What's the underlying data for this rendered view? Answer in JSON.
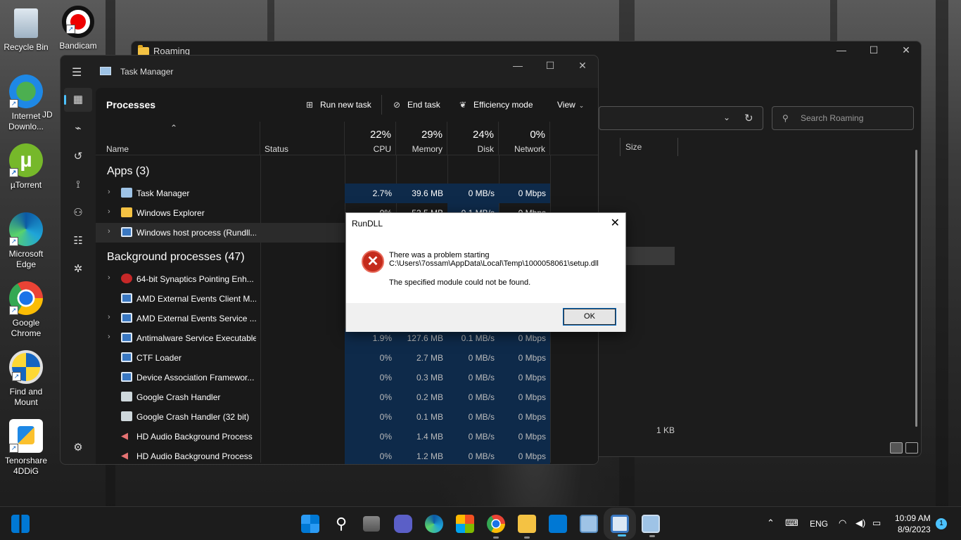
{
  "desktop": {
    "icons": [
      {
        "label": "Recycle Bin",
        "icon": "recycle-bin-icon"
      },
      {
        "label": "Bandicam",
        "icon": "bandicam-icon"
      },
      {
        "label": "Internet Downlo...",
        "icon": "idm-icon"
      },
      {
        "label": "JD",
        "icon": "jd-icon"
      },
      {
        "label": "µTorrent",
        "icon": "utorrent-icon"
      },
      {
        "label": "Microsoft Edge",
        "icon": "edge-icon"
      },
      {
        "label": "Google Chrome",
        "icon": "chrome-icon"
      },
      {
        "label": "Find and Mount",
        "icon": "find-mount-icon"
      },
      {
        "label": "Tenorshare 4DDiG",
        "icon": "tenorshare-icon"
      }
    ]
  },
  "explorer": {
    "title": "Roaming",
    "search_placeholder": "Search Roaming",
    "column_size": "Size",
    "file_size": "1 KB"
  },
  "taskmanager": {
    "title": "Task Manager",
    "section": "Processes",
    "toolbar": {
      "run_new_task": "Run new task",
      "end_task": "End task",
      "efficiency_mode": "Efficiency mode",
      "view": "View"
    },
    "columns": {
      "name": "Name",
      "status": "Status",
      "cpu_pct": "22%",
      "cpu": "CPU",
      "mem_pct": "29%",
      "mem": "Memory",
      "disk_pct": "24%",
      "disk": "Disk",
      "net_pct": "0%",
      "net": "Network"
    },
    "groups": {
      "apps": "Apps (3)",
      "background": "Background processes (47)"
    },
    "apps": [
      {
        "name": "Task Manager",
        "cpu": "2.7%",
        "mem": "39.6 MB",
        "disk": "0 MB/s",
        "net": "0 Mbps"
      },
      {
        "name": "Windows Explorer",
        "cpu": "0%",
        "mem": "53.5 MB",
        "disk": "0.1 MB/s",
        "net": "0 Mbps"
      },
      {
        "name": "Windows host process (Rundll...",
        "cpu": "",
        "mem": "",
        "disk": "",
        "net": ""
      }
    ],
    "background": [
      {
        "name": "64-bit Synaptics Pointing Enh...",
        "cpu": "",
        "mem": "",
        "disk": "",
        "net": ""
      },
      {
        "name": "AMD External Events Client M...",
        "cpu": "",
        "mem": "",
        "disk": "",
        "net": ""
      },
      {
        "name": "AMD External Events Service ...",
        "cpu": "",
        "mem": "",
        "disk": "",
        "net": ""
      },
      {
        "name": "Antimalware Service Executable",
        "cpu": "1.9%",
        "mem": "127.6 MB",
        "disk": "0.1 MB/s",
        "net": "0 Mbps"
      },
      {
        "name": "CTF Loader",
        "cpu": "0%",
        "mem": "2.7 MB",
        "disk": "0 MB/s",
        "net": "0 Mbps"
      },
      {
        "name": "Device Association Framewor...",
        "cpu": "0%",
        "mem": "0.3 MB",
        "disk": "0 MB/s",
        "net": "0 Mbps"
      },
      {
        "name": "Google Crash Handler",
        "cpu": "0%",
        "mem": "0.2 MB",
        "disk": "0 MB/s",
        "net": "0 Mbps"
      },
      {
        "name": "Google Crash Handler (32 bit)",
        "cpu": "0%",
        "mem": "0.1 MB",
        "disk": "0 MB/s",
        "net": "0 Mbps"
      },
      {
        "name": "HD Audio Background Process",
        "cpu": "0%",
        "mem": "1.4 MB",
        "disk": "0 MB/s",
        "net": "0 Mbps"
      },
      {
        "name": "HD Audio Background Process",
        "cpu": "0%",
        "mem": "1.2 MB",
        "disk": "0 MB/s",
        "net": "0 Mbps"
      }
    ]
  },
  "dialog": {
    "title": "RunDLL",
    "line1": "There was a problem starting",
    "line2": "C:\\Users\\7ossam\\AppData\\Local\\Temp\\1000058061\\setup.dll",
    "line3": "The specified module could not be found.",
    "ok": "OK"
  },
  "taskbar": {
    "lang": "ENG",
    "time": "10:09 AM",
    "date": "8/9/2023",
    "notifications": "1"
  },
  "colors": {
    "accent": "#4cc2ff",
    "error": "#c42b1c",
    "highlight": "#0e2a4a"
  }
}
